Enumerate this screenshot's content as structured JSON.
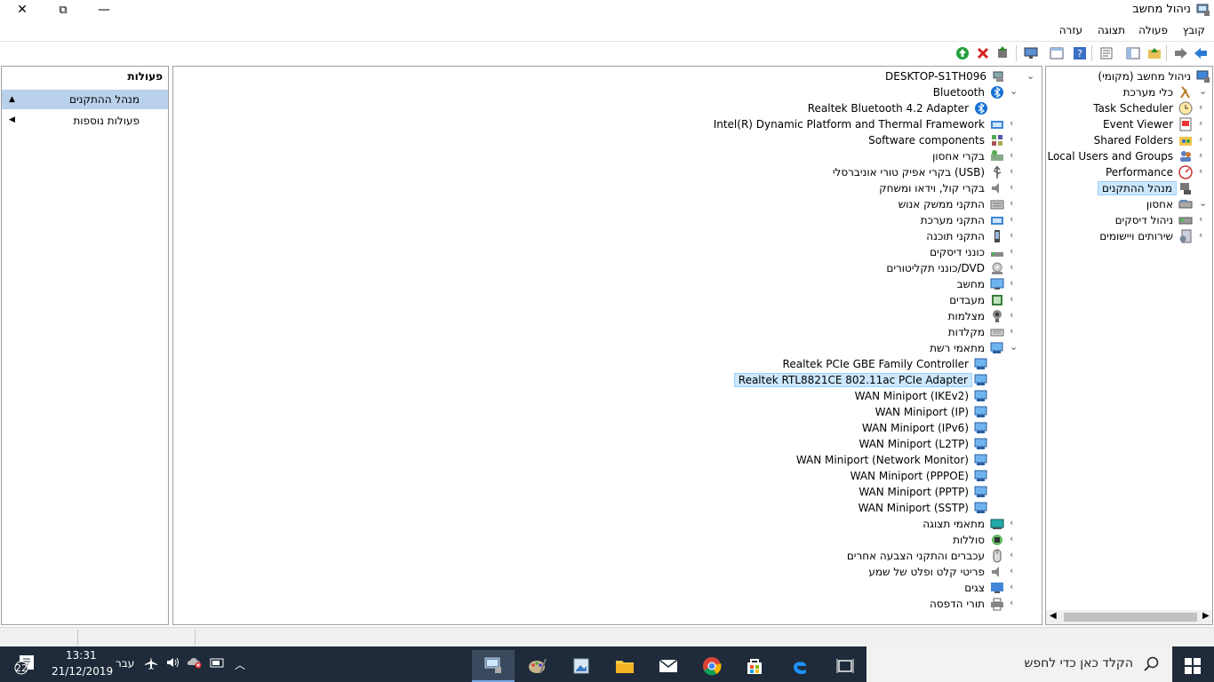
{
  "window": {
    "title": "ניהול מחשב",
    "controls": {
      "close": "✕",
      "restore": "⧉",
      "minimize": "—"
    }
  },
  "menu": {
    "items": [
      "קובץ",
      "פעולה",
      "תצוגה",
      "עזרה"
    ]
  },
  "actions": {
    "header": "פעולות",
    "items": [
      {
        "label": "מנהל ההתקנים",
        "selected": true
      },
      {
        "label": "פעולות נוספות",
        "selected": false
      }
    ]
  },
  "device_tree": {
    "root": "DESKTOP-S1TH096",
    "rows": [
      {
        "label": "Bluetooth",
        "level": 1,
        "expanded": true,
        "icon": "bluetooth-icon"
      },
      {
        "label": "Realtek Bluetooth 4.2 Adapter",
        "level": 2,
        "icon": "bluetooth-icon"
      },
      {
        "label": "Intel(R) Dynamic Platform and Thermal Framework",
        "level": 1,
        "icon": "folder-device-icon"
      },
      {
        "label": "Software components",
        "level": 1,
        "icon": "components-icon"
      },
      {
        "label": "בקרי אחסון",
        "level": 1,
        "icon": "storage-controller-icon"
      },
      {
        "label": "בקרי אפיק טורי אוניברסלי (USB)",
        "level": 1,
        "icon": "usb-icon"
      },
      {
        "label": "בקרי קול, וידאו ומשחק",
        "level": 1,
        "icon": "speaker-icon"
      },
      {
        "label": "התקני ממשק אנוש",
        "level": 1,
        "icon": "hid-icon"
      },
      {
        "label": "התקני מערכת",
        "level": 1,
        "icon": "folder-device-icon"
      },
      {
        "label": "התקני תוכנה",
        "level": 1,
        "icon": "software-device-icon"
      },
      {
        "label": "כונני דיסקים",
        "level": 1,
        "icon": "disk-drive-icon"
      },
      {
        "label": "כונני תקליטורים/DVD",
        "level": 1,
        "icon": "dvd-icon"
      },
      {
        "label": "מחשב",
        "level": 1,
        "icon": "computer-icon"
      },
      {
        "label": "מעבדים",
        "level": 1,
        "icon": "processor-icon"
      },
      {
        "label": "מצלמות",
        "level": 1,
        "icon": "camera-icon"
      },
      {
        "label": "מקלדות",
        "level": 1,
        "icon": "keyboard-icon"
      },
      {
        "label": "מתאמי רשת",
        "level": 1,
        "expanded": true,
        "icon": "network-adapter-icon"
      },
      {
        "label": "Realtek PCIe GBE Family Controller",
        "level": 2,
        "icon": "network-adapter-icon"
      },
      {
        "label": "Realtek RTL8821CE 802.11ac PCIe Adapter",
        "level": 2,
        "selected": true,
        "icon": "network-adapter-icon"
      },
      {
        "label": "WAN Miniport (IKEv2)",
        "level": 2,
        "icon": "network-adapter-icon"
      },
      {
        "label": "WAN Miniport (IP)",
        "level": 2,
        "icon": "network-adapter-icon"
      },
      {
        "label": "WAN Miniport (IPv6)",
        "level": 2,
        "icon": "network-adapter-icon"
      },
      {
        "label": "WAN Miniport (L2TP)",
        "level": 2,
        "icon": "network-adapter-icon"
      },
      {
        "label": "WAN Miniport (Network Monitor)",
        "level": 2,
        "icon": "network-adapter-icon"
      },
      {
        "label": "WAN Miniport (PPPOE)",
        "level": 2,
        "icon": "network-adapter-icon"
      },
      {
        "label": "WAN Miniport (PPTP)",
        "level": 2,
        "icon": "network-adapter-icon"
      },
      {
        "label": "WAN Miniport (SSTP)",
        "level": 2,
        "icon": "network-adapter-icon"
      },
      {
        "label": "מתאמי תצוגה",
        "level": 1,
        "icon": "display-adapter-icon"
      },
      {
        "label": "סוללות",
        "level": 1,
        "icon": "battery-icon"
      },
      {
        "label": "עכברים והתקני הצבעה אחרים",
        "level": 1,
        "icon": "mouse-icon"
      },
      {
        "label": "פריטי קלט ופלט של שמע",
        "level": 1,
        "icon": "speaker-icon"
      },
      {
        "label": "צגים",
        "level": 1,
        "icon": "monitor-icon"
      },
      {
        "label": "תורי הדפסה",
        "level": 1,
        "icon": "printer-icon"
      }
    ]
  },
  "nav_tree": {
    "rows": [
      {
        "label": "ניהול מחשב (מקומי)",
        "level": 0,
        "icon": "computer-management-icon"
      },
      {
        "label": "כלי מערכת",
        "level": 1,
        "expanded": true,
        "icon": "tools-icon"
      },
      {
        "label": "Task Scheduler",
        "level": 2,
        "icon": "clock-icon"
      },
      {
        "label": "Event Viewer",
        "level": 2,
        "icon": "event-viewer-icon"
      },
      {
        "label": "Shared Folders",
        "level": 2,
        "icon": "shared-folder-icon"
      },
      {
        "label": "Local Users and Groups",
        "level": 2,
        "icon": "users-icon"
      },
      {
        "label": "Performance",
        "level": 2,
        "icon": "performance-icon"
      },
      {
        "label": "מנהל ההתקנים",
        "level": 2,
        "selected": true,
        "icon": "device-manager-icon"
      },
      {
        "label": "אחסון",
        "level": 1,
        "expanded": true,
        "icon": "storage-icon"
      },
      {
        "label": "ניהול דיסקים",
        "level": 2,
        "icon": "disk-management-icon"
      },
      {
        "label": "שירותים ויישומים",
        "level": 1,
        "icon": "services-icon"
      }
    ]
  },
  "taskbar": {
    "search_placeholder": "הקלד כאן כדי לחפש",
    "time": "13:31",
    "date": "21/12/2019",
    "language": "עבר",
    "notification_count": "22"
  }
}
